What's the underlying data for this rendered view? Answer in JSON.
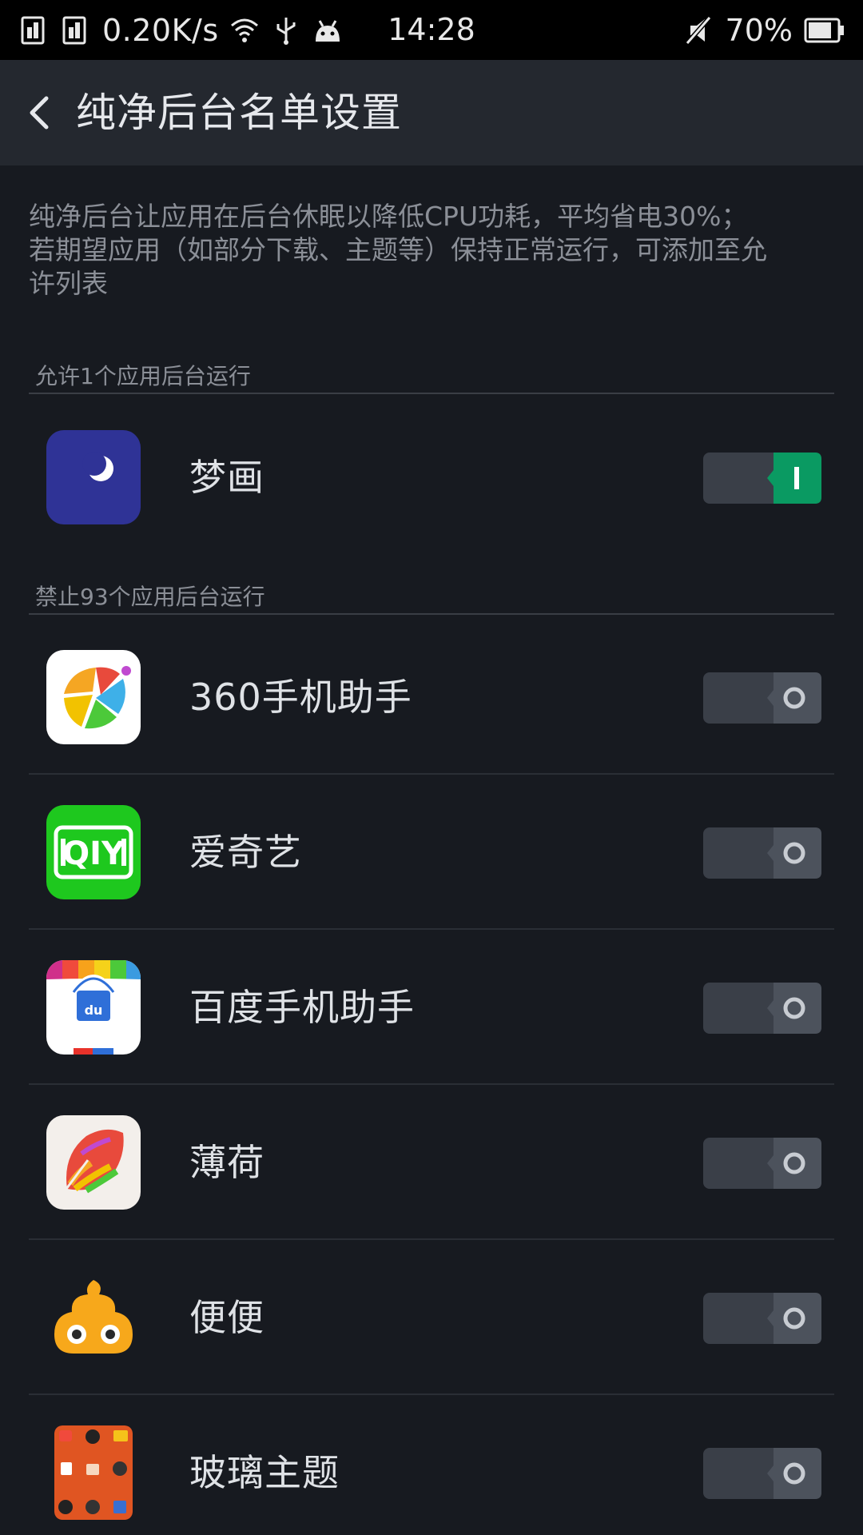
{
  "status_bar": {
    "net_speed": "0.20K/s",
    "time": "14:28",
    "battery": "70%",
    "icons": [
      "sim1-icon",
      "sim2-icon",
      "wifi-icon",
      "usb-icon",
      "android-icon",
      "mute-icon",
      "battery-icon"
    ]
  },
  "header": {
    "title": "纯净后台名单设置",
    "back_icon": "back-arrow-icon"
  },
  "description": {
    "line1": "纯净后台让应用在后台休眠以降低CPU功耗，平均省电30%；",
    "line2": "若期望应用（如部分下载、主题等）保持正常运行，可添加至允",
    "line3": "许列表"
  },
  "sections": {
    "allowed": {
      "label": "允许1个应用后台运行"
    },
    "blocked": {
      "label": "禁止93个应用后台运行"
    }
  },
  "apps": {
    "allowed": [
      {
        "name": "梦画",
        "enabled": true,
        "icon": "menghua-moon-icon",
        "color": "#2f3396"
      }
    ],
    "blocked": [
      {
        "name": "360手机助手",
        "enabled": false,
        "icon": "360-assistant-icon"
      },
      {
        "name": "爱奇艺",
        "enabled": false,
        "icon": "iqiyi-icon",
        "color": "#1ec81e"
      },
      {
        "name": "百度手机助手",
        "enabled": false,
        "icon": "baidu-assistant-icon"
      },
      {
        "name": "薄荷",
        "enabled": false,
        "icon": "bohe-leaf-icon"
      },
      {
        "name": "便便",
        "enabled": false,
        "icon": "bianbian-poop-icon",
        "color": "#f7a81b"
      },
      {
        "name": "玻璃主题",
        "enabled": false,
        "icon": "glass-theme-icon",
        "color": "#d84a1a"
      }
    ]
  },
  "colors": {
    "background": "#171a20",
    "toolbar": "#24282f",
    "toggle_on": "#0a9a62",
    "toggle_off": "#3a3f48"
  }
}
